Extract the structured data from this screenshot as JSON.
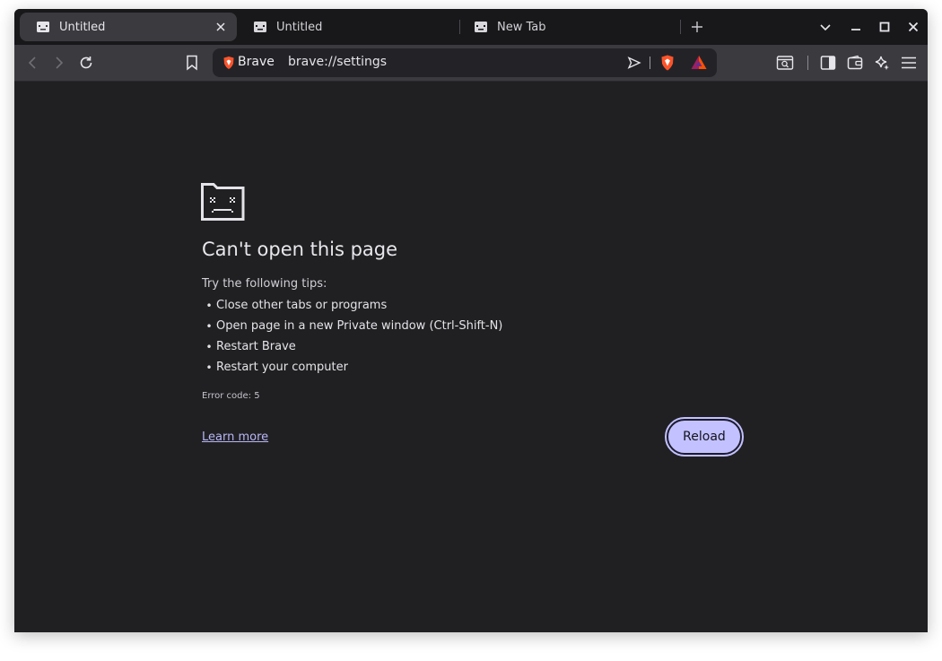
{
  "tabs": [
    {
      "title": "Untitled",
      "active": true,
      "icon": "sad-folder-icon",
      "close_icon": "close-icon"
    },
    {
      "title": "Untitled",
      "active": false,
      "icon": "sad-folder-icon"
    },
    {
      "title": "New Tab",
      "active": false,
      "icon": "sad-folder-icon"
    }
  ],
  "tabstrip_controls": {
    "new_tab_icon": "plus-icon",
    "tab_search_icon": "chevron-down-icon",
    "minimize_icon": "minimize-icon",
    "maximize_icon": "maximize-icon",
    "close_window_icon": "close-icon"
  },
  "toolbar": {
    "back_icon": "back-arrow-icon",
    "forward_icon": "forward-arrow-icon",
    "reload_icon": "reload-icon",
    "bookmark_icon": "bookmark-icon",
    "right_icons": [
      "tab-search-icon",
      "sidebar-icon",
      "wallet-icon",
      "leo-ai-icon",
      "menu-icon"
    ]
  },
  "omnibox": {
    "site_label": "Brave",
    "url": "brave://settings",
    "shield_icon": "brave-shield-icon",
    "send_icon": "send-icon",
    "brave_shields_icon": "brave-lion-icon",
    "rewards_icon": "bat-rewards-icon"
  },
  "error_page": {
    "icon": "sad-folder-icon",
    "title": "Can't open this page",
    "tips_heading": "Try the following tips:",
    "tips": [
      "Close other tabs or programs",
      "Open page in a new Private window (Ctrl-Shift-N)",
      "Restart Brave",
      "Restart your computer"
    ],
    "error_code": "Error code: 5",
    "learn_more": "Learn more",
    "reload_label": "Reload"
  },
  "colors": {
    "page_background": "#202023",
    "toolbar_background": "#3a3a3f",
    "tabstrip_background": "#18181b",
    "accent": "#c3c1ff",
    "link": "#b9b7f6"
  }
}
